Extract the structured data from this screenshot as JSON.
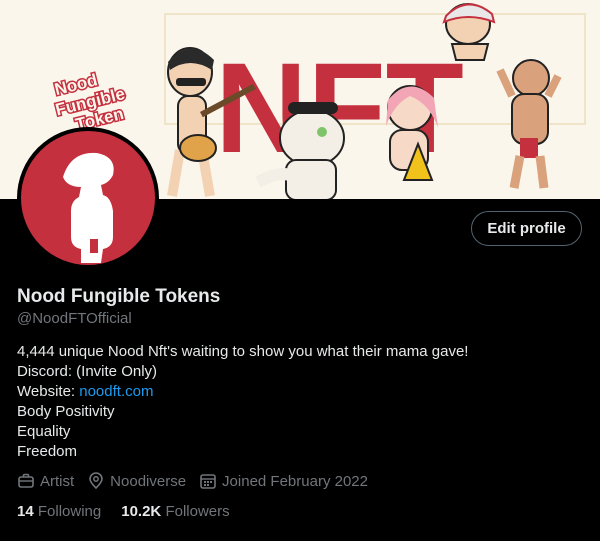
{
  "banner": {
    "logo_lines": [
      "Nood",
      "Fungible",
      "Token"
    ],
    "big_text": "NFT"
  },
  "profile": {
    "name": "Nood Fungible Tokens",
    "handle": "@NoodFTOfficial",
    "edit_label": "Edit profile",
    "bio": {
      "line1": "4,444 unique Nood Nft's waiting to show you what their mama gave!",
      "line2": "Discord: (Invite Only)",
      "website_label": "Website: ",
      "website_link": "noodft.com",
      "line4": "Body Positivity",
      "line5": "Equality",
      "line6": "Freedom"
    },
    "meta": {
      "category": "Artist",
      "location": "Noodiverse",
      "joined": "Joined February 2022"
    },
    "stats": {
      "following_count": "14",
      "following_label": "Following",
      "followers_count": "10.2K",
      "followers_label": "Followers"
    }
  },
  "colors": {
    "brand_red": "#c5303f",
    "link": "#1d9bf0",
    "muted": "#71767b"
  },
  "icons": [
    "briefcase-icon",
    "location-pin-icon",
    "calendar-icon"
  ]
}
